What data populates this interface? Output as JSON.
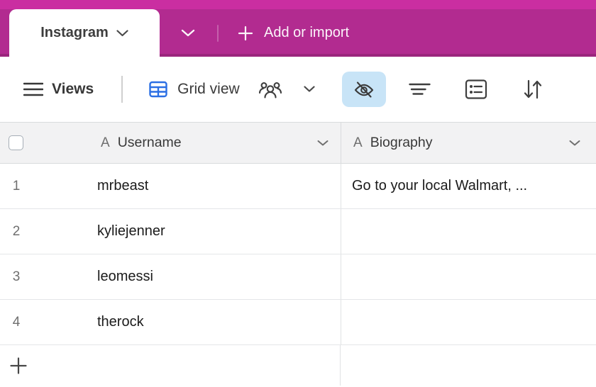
{
  "topbar": {
    "active_tab": "Instagram",
    "add_or_import_label": "Add or import"
  },
  "toolbar": {
    "views_label": "Views",
    "view_name": "Grid view",
    "hide_fields_active": true
  },
  "table": {
    "columns": [
      {
        "name": "Username",
        "type_icon_char": "A"
      },
      {
        "name": "Biography",
        "type_icon_char": "A"
      }
    ],
    "rows": [
      {
        "num": "1",
        "username": "mrbeast",
        "biography": "Go to your local Walmart, ..."
      },
      {
        "num": "2",
        "username": "kyliejenner",
        "biography": ""
      },
      {
        "num": "3",
        "username": "leomessi",
        "biography": ""
      },
      {
        "num": "4",
        "username": "therock",
        "biography": ""
      }
    ]
  },
  "icons": {
    "tab_chevron": "chevron-down-icon",
    "tables_expand": "chevron-down-icon",
    "add_import": "plus-icon",
    "views": "hamburger-menu-icon",
    "view_type": "grid-table-icon",
    "collaborators": "people-icon",
    "view_chevron": "chevron-down-icon",
    "hide_fields": "eye-slash-icon",
    "filter": "filter-lines-icon",
    "group": "group-list-icon",
    "sort": "sort-arrows-icon",
    "add_row": "plus-icon"
  },
  "colors": {
    "topstrip_magenta": "#CA2EA1",
    "tabbar_magenta": "#B22B90",
    "grid_icon_blue": "#2B6FE4",
    "hide_button_bg": "#C8E4F7",
    "header_bg": "#F2F2F3",
    "row_border": "#E4E6E8"
  }
}
